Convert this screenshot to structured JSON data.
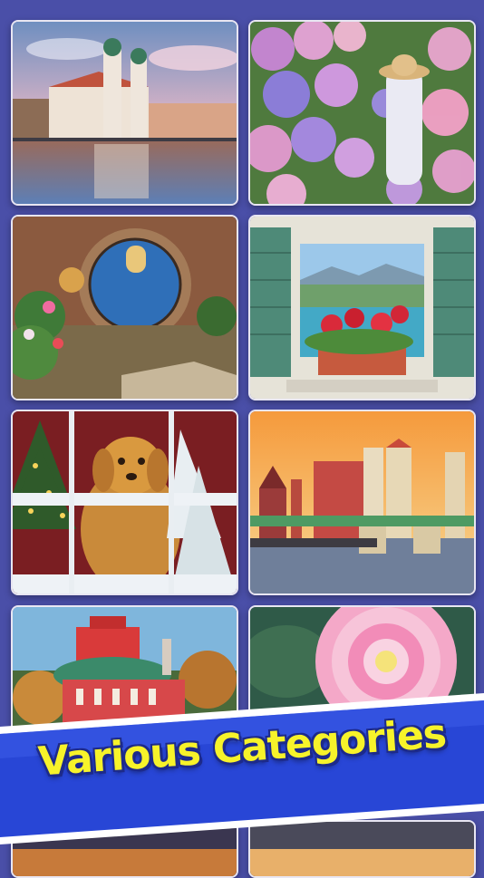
{
  "banner": {
    "title": "Various Categories"
  },
  "colors": {
    "background": "#4a4fa8",
    "banner_blue": "#2846d6",
    "banner_text": "#f7f32a"
  },
  "tiles": [
    {
      "subject": "lakeside-church"
    },
    {
      "subject": "hydrangea-garden"
    },
    {
      "subject": "round-blue-door"
    },
    {
      "subject": "window-sea-view"
    },
    {
      "subject": "christmas-puppy"
    },
    {
      "subject": "sunset-bridge-city"
    },
    {
      "subject": "red-theater"
    },
    {
      "subject": "pink-dahlia"
    }
  ]
}
